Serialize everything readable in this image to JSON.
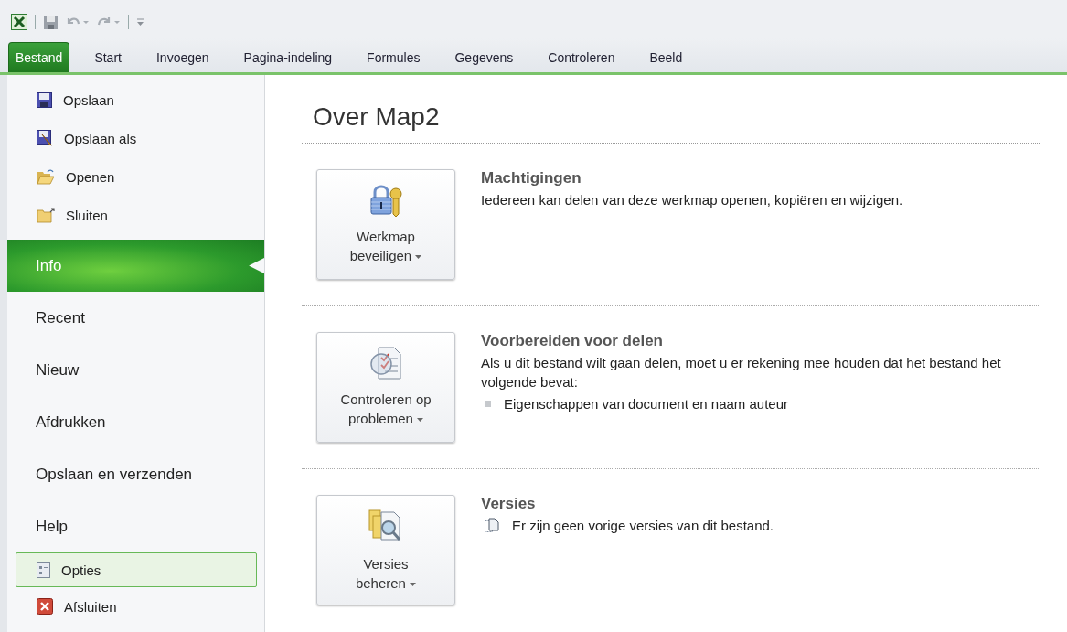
{
  "tabs": [
    {
      "label": "Bestand",
      "selected": true
    },
    {
      "label": "Start",
      "selected": false
    },
    {
      "label": "Invoegen",
      "selected": false
    },
    {
      "label": "Pagina-indeling",
      "selected": false
    },
    {
      "label": "Formules",
      "selected": false
    },
    {
      "label": "Gegevens",
      "selected": false
    },
    {
      "label": "Controleren",
      "selected": false
    },
    {
      "label": "Beeld",
      "selected": false
    }
  ],
  "sidebar": {
    "items": [
      {
        "kind": "command",
        "label": "Opslaan",
        "selected": false,
        "highlighted": false
      },
      {
        "kind": "command",
        "label": "Opslaan als",
        "selected": false,
        "highlighted": false
      },
      {
        "kind": "command",
        "label": "Openen",
        "selected": false,
        "highlighted": false
      },
      {
        "kind": "command",
        "label": "Sluiten",
        "selected": false,
        "highlighted": false
      },
      {
        "kind": "page",
        "label": "Info",
        "selected": true,
        "highlighted": false
      },
      {
        "kind": "page",
        "label": "Recent",
        "selected": false,
        "highlighted": false
      },
      {
        "kind": "page",
        "label": "Nieuw",
        "selected": false,
        "highlighted": false
      },
      {
        "kind": "page",
        "label": "Afdrukken",
        "selected": false,
        "highlighted": false
      },
      {
        "kind": "page",
        "label": "Opslaan en verzenden",
        "selected": false,
        "highlighted": false
      },
      {
        "kind": "page",
        "label": "Help",
        "selected": false,
        "highlighted": false
      },
      {
        "kind": "command",
        "label": "Opties",
        "selected": false,
        "highlighted": true
      },
      {
        "kind": "command",
        "label": "Afsluiten",
        "selected": false,
        "highlighted": false
      }
    ]
  },
  "title": "Over Map2",
  "sections": [
    {
      "button": [
        "Werkmap",
        "beveiligen"
      ],
      "heading": "Machtigingen",
      "text": "Iedereen kan delen van deze werkmap openen, kopiëren en wijzigen."
    },
    {
      "button": [
        "Controleren op",
        "problemen"
      ],
      "heading": "Voorbereiden voor delen",
      "text": "Als u dit bestand wilt gaan delen, moet u er rekening mee houden dat het bestand het volgende bevat:",
      "items": [
        {
          "kind": "bullet",
          "text": "Eigenschappen van document en naam auteur"
        }
      ]
    },
    {
      "button": [
        "Versies",
        "beheren"
      ],
      "heading": "Versies",
      "items": [
        {
          "kind": "note",
          "text": "Er zijn geen vorige versies van dit bestand."
        }
      ]
    }
  ]
}
